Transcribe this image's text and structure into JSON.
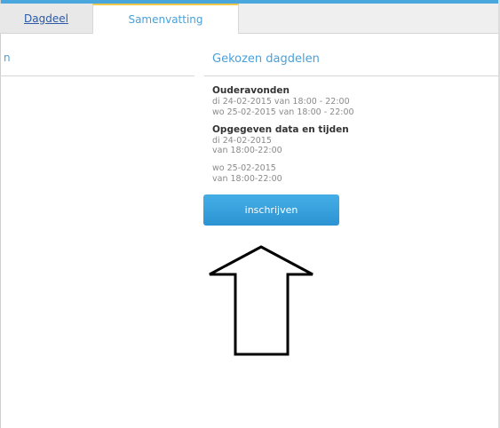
{
  "tabs": [
    {
      "label": "Dagdeel"
    },
    {
      "label": "Samenvatting"
    }
  ],
  "left_fragment": "n",
  "summary": {
    "title": "Gekozen dagdelen",
    "groups": [
      {
        "title": "Ouderavonden",
        "lines": [
          "di 24-02-2015 van 18:00 - 22:00",
          "wo 25-02-2015 van 18:00 - 22:00"
        ]
      },
      {
        "title": "Opgegeven data en tijden",
        "lines": [
          "di 24-02-2015",
          "van 18:00-22:00",
          "wo 25-02-2015",
          "van 18:00-22:00"
        ]
      }
    ]
  },
  "button": {
    "label": "inschrijven"
  },
  "annotation": {
    "icon": "arrow-up-icon"
  },
  "colors": {
    "accent": "#4aa0d8",
    "button": "#2b93d2",
    "active_tab_border": "#f0c94a"
  }
}
